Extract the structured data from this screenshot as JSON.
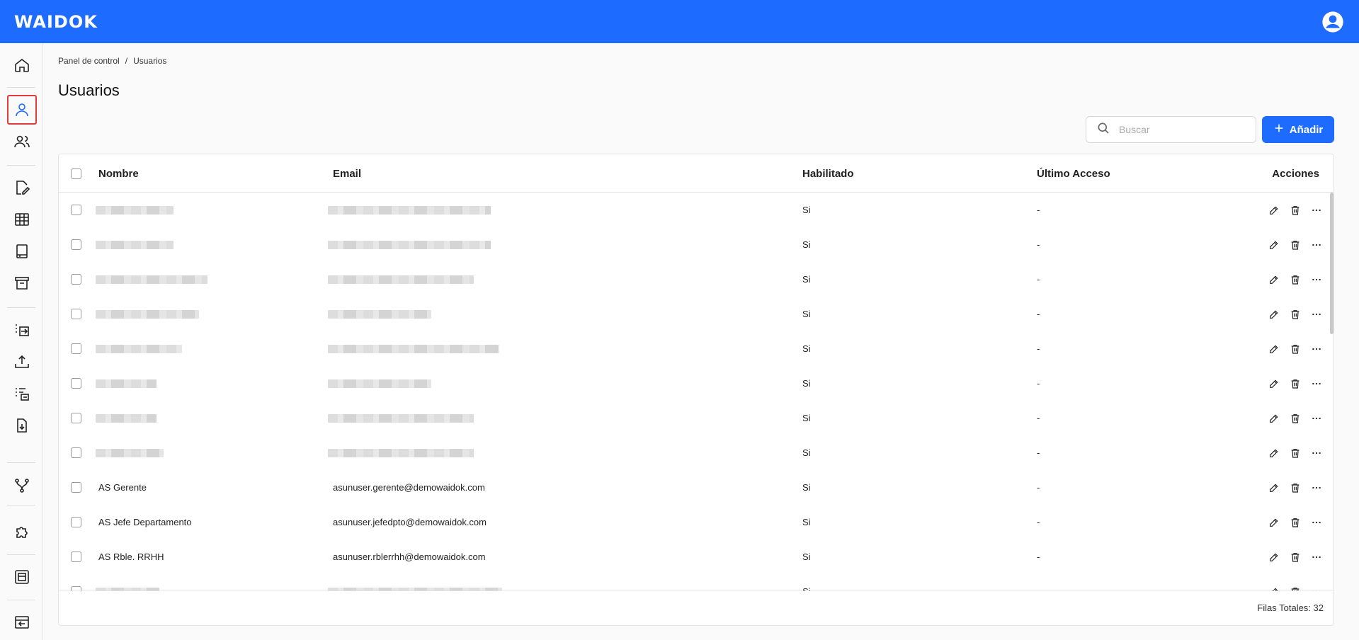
{
  "app": {
    "logo": "WAIDOK"
  },
  "breadcrumb": {
    "root": "Panel de control",
    "separator": "/",
    "current": "Usuarios"
  },
  "page": {
    "title": "Usuarios"
  },
  "search": {
    "placeholder": "Buscar",
    "value": ""
  },
  "add_button": {
    "label": "Añadir",
    "icon": "plus-icon"
  },
  "table": {
    "columns": {
      "name": "Nombre",
      "email": "Email",
      "enabled": "Habilitado",
      "last_access": "Último Acceso",
      "actions": "Acciones"
    },
    "rows": [
      {
        "name": "",
        "email": "",
        "enabled": "Si",
        "last_access": "-",
        "redacted": true
      },
      {
        "name": "",
        "email": "",
        "enabled": "Si",
        "last_access": "-",
        "redacted": true
      },
      {
        "name": "",
        "email": "",
        "enabled": "Si",
        "last_access": "-",
        "redacted": true
      },
      {
        "name": "",
        "email": "",
        "enabled": "Si",
        "last_access": "-",
        "redacted": true
      },
      {
        "name": "",
        "email": "",
        "enabled": "Si",
        "last_access": "-",
        "redacted": true
      },
      {
        "name": "",
        "email": "",
        "enabled": "Si",
        "last_access": "-",
        "redacted": true
      },
      {
        "name": "",
        "email": "",
        "enabled": "Si",
        "last_access": "-",
        "redacted": true
      },
      {
        "name": "",
        "email": "",
        "enabled": "Si",
        "last_access": "-",
        "redacted": true
      },
      {
        "name": "AS Gerente",
        "email": "asunuser.gerente@demowaidok.com",
        "enabled": "Si",
        "last_access": "-",
        "redacted": false
      },
      {
        "name": "AS Jefe Departamento",
        "email": "asunuser.jefedpto@demowaidok.com",
        "enabled": "Si",
        "last_access": "-",
        "redacted": false
      },
      {
        "name": "AS Rble. RRHH",
        "email": "asunuser.rblerrhh@demowaidok.com",
        "enabled": "Si",
        "last_access": "-",
        "redacted": false
      },
      {
        "name": "",
        "email": "",
        "enabled": "Si",
        "last_access": "-",
        "redacted": true
      }
    ],
    "footer": "Filas Totales: 32"
  },
  "sidebar": {
    "items": [
      {
        "icon": "home-icon"
      },
      {
        "icon": "user-icon",
        "active": true
      },
      {
        "icon": "users-icon"
      },
      {
        "icon": "document-sign-icon"
      },
      {
        "icon": "table-icon"
      },
      {
        "icon": "book-icon"
      },
      {
        "icon": "archive-icon"
      },
      {
        "icon": "transfer-icon"
      },
      {
        "icon": "upload-icon"
      },
      {
        "icon": "list-import-icon"
      },
      {
        "icon": "download-doc-icon"
      },
      {
        "icon": "workflow-icon"
      },
      {
        "icon": "puzzle-icon"
      },
      {
        "icon": "template-icon"
      },
      {
        "icon": "logout-window-icon"
      }
    ]
  },
  "colors": {
    "primary": "#1e6bff",
    "active_outline": "#e23b3b"
  }
}
